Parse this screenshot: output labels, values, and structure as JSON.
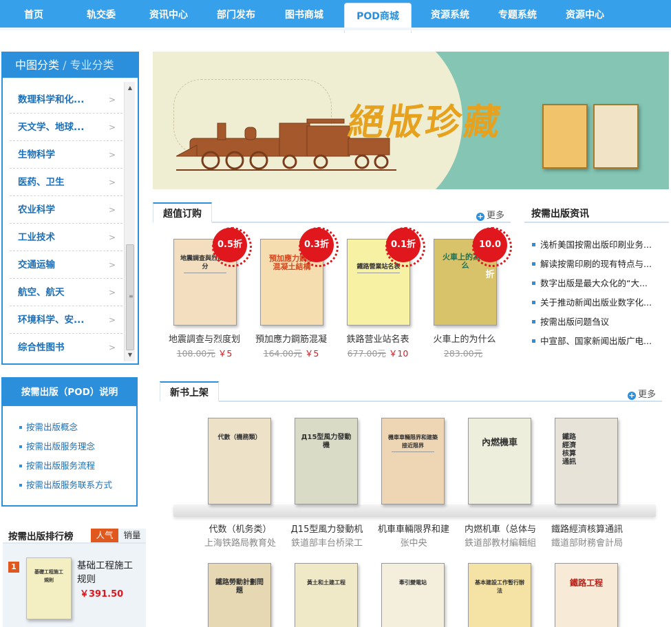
{
  "nav": {
    "items": [
      "首页",
      "轨交委",
      "资讯中心",
      "部门发布",
      "图书商城",
      "POD商城",
      "资源系统",
      "专题系统",
      "资源中心"
    ],
    "active": "POD商城"
  },
  "sidebar": {
    "title": "中图分类",
    "separator": "/",
    "alt_title": "专业分类",
    "categories": [
      "数理科学和化...",
      "天文学、地球...",
      "生物科学",
      "医药、卫生",
      "农业科学",
      "工业技术",
      "交通运输",
      "航空、航天",
      "环境科学、安...",
      "综合性图书"
    ]
  },
  "banner": {
    "title": "絕版珍藏"
  },
  "deals": {
    "tab": "超值订购",
    "more": "更多",
    "items": [
      {
        "cover_title": "地震調查與烈度劃分",
        "discount": "0.5折",
        "name": "地震調查与烈度划",
        "old_price": "108.00元",
        "new_price": "￥5",
        "color": "#f3dfbf"
      },
      {
        "cover_title": "預加應力鋼筋混凝土結構",
        "discount": "0.3折",
        "name": "預加應力鋼筋混凝",
        "old_price": "164.00元",
        "new_price": "￥5",
        "color": "#f5ddb0"
      },
      {
        "cover_title": "鐵路營業站名表",
        "discount": "0.1折",
        "name": "鉄路营业站名表",
        "old_price": "677.00元",
        "new_price": "￥10",
        "color": "#f7f1a4"
      },
      {
        "cover_title": "火車上的為什么",
        "discount": "10.0折",
        "name": "火車上的为什么",
        "old_price": "283.00元",
        "new_price": "",
        "color": "#d8c36a"
      }
    ]
  },
  "news": {
    "title": "按需出版资讯",
    "items": [
      "浅析美国按需出版印刷业务...",
      "解读按需印刷的现有特点与...",
      "数字出版是最大众化的“大...",
      "关于推动新闻出版业数字化...",
      "按需出版问题刍议",
      "中宣部、国家新闻出版广电..."
    ]
  },
  "pod": {
    "title": "按需出版（POD）说明",
    "items": [
      "按需出版概念",
      "按需出版服务理念",
      "按需出版服务流程",
      "按需出版服务联系方式"
    ]
  },
  "ranking": {
    "title": "按需出版排行榜",
    "tabs": [
      "人气",
      "销量"
    ],
    "first": {
      "rank": "1",
      "cover_title": "基礎工程施工規則",
      "name": "基础工程施工规则",
      "price": "￥391.50"
    }
  },
  "new_books": {
    "tab": "新书上架",
    "more": "更多",
    "row1": [
      {
        "cover_title": "代數（機務類）",
        "title": "代数（机务类）",
        "publisher": "上海铁路局教育处",
        "color": "#ede2c8"
      },
      {
        "cover_title": "Д15型風力發動機",
        "title": "Д15型風力發動机",
        "publisher": "鉄道部丰台桥梁工",
        "color": "#d9dbc6"
      },
      {
        "cover_title": "機車車輛限界和建築接近限界",
        "title": "机車車輛限界和建",
        "publisher": "张中央",
        "color": "#eed5b4"
      },
      {
        "cover_title": "內燃機車",
        "title": "内燃机車（总体与",
        "publisher": "鉄道部教材編輯組",
        "color": "#eeeedd"
      },
      {
        "cover_title": "鐵路經濟核算通訊",
        "title": "鐵路經濟核算通訊",
        "publisher": "鐵道部財務會計局",
        "color": "#e7e3d8"
      }
    ],
    "row2": [
      {
        "cover_title": "鐵路勞動計劃問題",
        "color": "#e7d8b4"
      },
      {
        "cover_title": "黃土和土建工程",
        "color": "#f0e9c8"
      },
      {
        "cover_title": "牽引變電站",
        "color": "#f4efdd"
      },
      {
        "cover_title": "基本建設工作暫行辦法",
        "color": "#f4e3a4"
      },
      {
        "cover_title": "鐵路工程",
        "color": "#f7ead6"
      }
    ]
  }
}
